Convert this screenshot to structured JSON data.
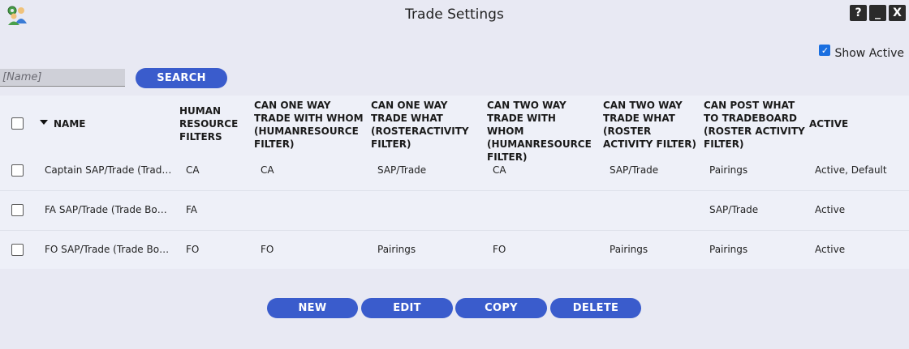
{
  "window": {
    "title": "Trade Settings",
    "controls": [
      "?",
      "_",
      "X"
    ]
  },
  "filter": {
    "show_active_label": "Show Active",
    "show_active_checked": true,
    "search_placeholder": "[Name]",
    "search_button": "SEARCH"
  },
  "table": {
    "columns": [
      "NAME",
      "HUMAN RESOURCE FILTERS",
      "CAN ONE WAY TRADE WITH WHOM (HUMANRESOURCE FILTER)",
      "CAN ONE WAY TRADE WHAT (ROSTERACTIVITY FILTER)",
      "CAN TWO WAY TRADE WITH WHOM (HUMANRESOURCE FILTER)",
      "CAN TWO WAY TRADE WHAT (ROSTER ACTIVITY FILTER)",
      "CAN POST WHAT TO TRADEBOARD (ROSTER ACTIVITY FILTER)",
      "ACTIVE"
    ],
    "rows": [
      [
        "Captain SAP/Trade (Trade...",
        "CA",
        "CA",
        "SAP/Trade",
        "CA",
        "SAP/Trade",
        "Pairings",
        "Active, Default"
      ],
      [
        "FA SAP/Trade (Trade Boar...",
        "FA",
        "",
        "",
        "",
        "",
        "SAP/Trade",
        "Active"
      ],
      [
        "FO SAP/Trade (Trade Boar...",
        "FO",
        "FO",
        "Pairings",
        "FO",
        "Pairings",
        "Pairings",
        "Active"
      ]
    ]
  },
  "actions": {
    "new": "NEW",
    "edit": "EDIT",
    "copy": "COPY",
    "delete": "DELETE"
  },
  "colors": {
    "accent": "#3a5ccc",
    "background": "#e8e9f3",
    "grid_background": "#eef0f8"
  }
}
